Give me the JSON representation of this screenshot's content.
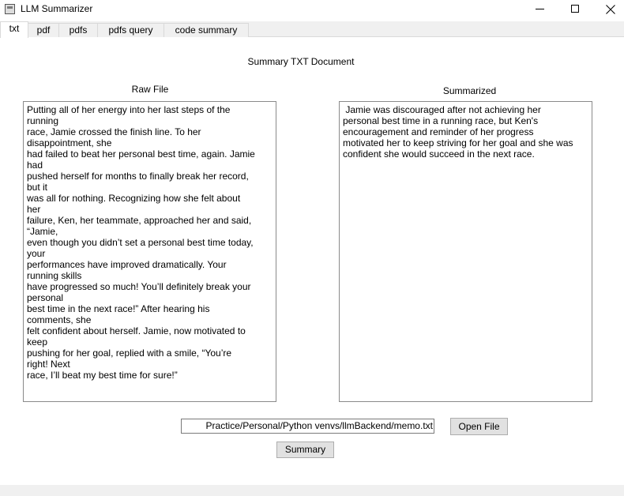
{
  "window": {
    "title": "LLM Summarizer"
  },
  "tabs": [
    {
      "label": "txt",
      "active": true
    },
    {
      "label": "pdf",
      "active": false
    },
    {
      "label": "pdfs",
      "active": false
    },
    {
      "label": "pdfs query",
      "active": false
    },
    {
      "label": "code summary",
      "active": false
    }
  ],
  "main": {
    "heading": "Summary TXT Document",
    "raw_label": "Raw File",
    "summarized_label": "Summarized",
    "raw_text": "Putting all of her energy into her last steps of the\nrunning\nrace, Jamie crossed the finish line. To her\ndisappointment, she\nhad failed to beat her personal best time, again. Jamie\nhad\npushed herself for months to finally break her record,\nbut it\nwas all for nothing. Recognizing how she felt about\nher\nfailure, Ken, her teammate, approached her and said,\n“Jamie,\neven though you didn’t set a personal best time today,\nyour\nperformances have improved dramatically. Your\nrunning skills\nhave progressed so much! You’ll definitely break your\npersonal\nbest time in the next race!” After hearing his\ncomments, she\nfelt confident about herself. Jamie, now motivated to\nkeep\npushing for her goal, replied with a smile, “You’re\nright! Next\nrace, I’ll beat my best time for sure!”",
    "summary_text": " Jamie was discouraged after not achieving her\npersonal best time in a running race, but Ken's\nencouragement and reminder of her progress\nmotivated her to keep striving for her goal and she was\nconfident she would succeed in the next race.",
    "file_path": "Practice/Personal/Python venvs/llmBackend/memo.txt",
    "open_button": "Open File",
    "summary_button": "Summary"
  }
}
